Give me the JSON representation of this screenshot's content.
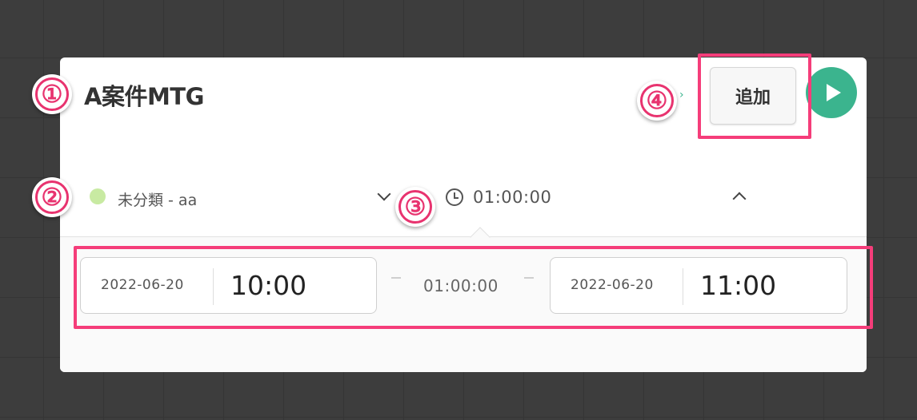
{
  "entry": {
    "title": "A案件MTG",
    "add_label": "追加",
    "project_label": "未分類 - aa",
    "project_color": "#c8eaa2",
    "duration": "01:00:00"
  },
  "time_range": {
    "start_date": "2022-06-20",
    "start_time": "10:00",
    "duration": "01:00:00",
    "end_date": "2022-06-20",
    "end_time": "11:00"
  },
  "badges": [
    "①",
    "②",
    "③",
    "④"
  ],
  "colors": {
    "accent": "#f53d7a",
    "play": "#3bb48e"
  }
}
